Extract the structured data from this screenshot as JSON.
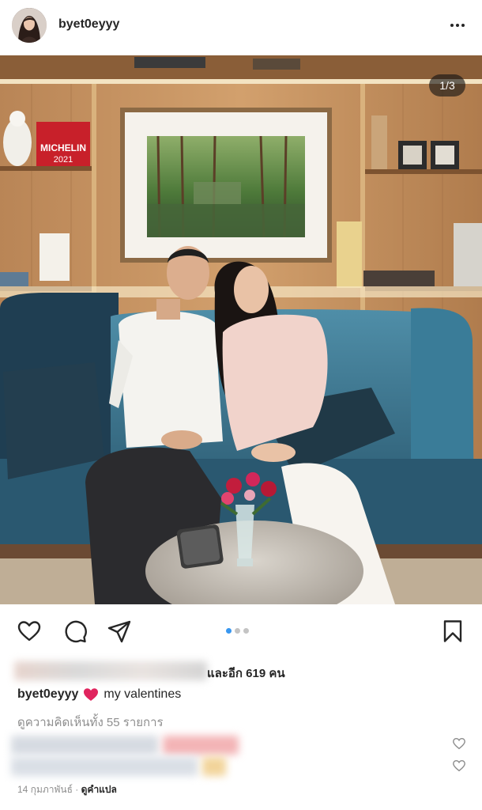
{
  "header": {
    "username": "byet0eyyy",
    "avatar_icon": "profile-photo"
  },
  "post": {
    "slide_counter": "1/3",
    "slides_total": 3,
    "slide_active": 1
  },
  "actions": {
    "like_icon": "heart-outline-icon",
    "comment_icon": "comment-bubble-icon",
    "share_icon": "paper-plane-icon",
    "save_icon": "bookmark-icon"
  },
  "likes": {
    "suffix": "และอีก 619 คน"
  },
  "caption": {
    "username": "byet0eyyy",
    "emoji": "red-heart",
    "text": "my valentines"
  },
  "comments": {
    "view_all": "ดูความคิดเห็นทั้ง 55 รายการ"
  },
  "meta": {
    "date": "14 กุมภาพันธ์",
    "separator": " · ",
    "translate": "ดูคำแปล"
  },
  "colors": {
    "primary_text": "#262626",
    "secondary_text": "#8e8e8e",
    "active_dot": "#3897f0",
    "inactive_dot": "#c4c4c4",
    "heart_emoji": "#e0245e"
  }
}
